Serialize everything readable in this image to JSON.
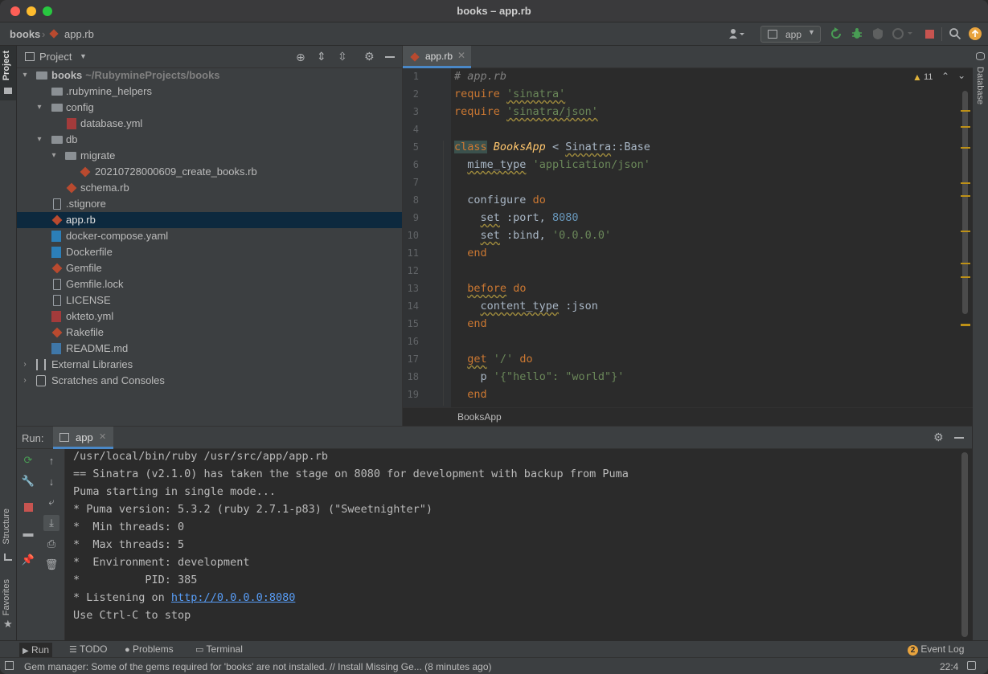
{
  "window": {
    "title": "books – app.rb"
  },
  "navbar": {
    "project": "books",
    "file": "app.rb",
    "run_config": "app"
  },
  "left_stripe": {
    "project": "Project",
    "structure": "Structure",
    "favorites": "Favorites"
  },
  "right_stripe": {
    "database": "Database"
  },
  "project_panel": {
    "title": "Project",
    "tree": [
      {
        "label": "books",
        "path": "~/RubymineProjects/books"
      },
      {
        "label": ".rubymine_helpers"
      },
      {
        "label": "config"
      },
      {
        "label": "database.yml"
      },
      {
        "label": "db"
      },
      {
        "label": "migrate"
      },
      {
        "label": "20210728000609_create_books.rb"
      },
      {
        "label": "schema.rb"
      },
      {
        "label": ".stignore"
      },
      {
        "label": "app.rb"
      },
      {
        "label": "docker-compose.yaml"
      },
      {
        "label": "Dockerfile"
      },
      {
        "label": "Gemfile"
      },
      {
        "label": "Gemfile.lock"
      },
      {
        "label": "LICENSE"
      },
      {
        "label": "okteto.yml"
      },
      {
        "label": "Rakefile"
      },
      {
        "label": "README.md"
      },
      {
        "label": "External Libraries"
      },
      {
        "label": "Scratches and Consoles"
      }
    ]
  },
  "editor": {
    "tab": "app.rb",
    "warnings": "11",
    "breadcrumb": "BooksApp",
    "line_numbers": [
      "1",
      "2",
      "3",
      "4",
      "5",
      "6",
      "7",
      "8",
      "9",
      "10",
      "11",
      "12",
      "13",
      "14",
      "15",
      "16",
      "17",
      "18",
      "19"
    ],
    "code": {
      "l1": "# app.rb",
      "l2_kw": "require",
      "l2_str": "'sinatra'",
      "l3_kw": "require",
      "l3_str": "'sinatra/json'",
      "l5_kw": "class",
      "l5_cls": "BooksApp",
      "l5_op": " < ",
      "l5_base": "Sinatra",
      "l5_sep": "::",
      "l5_base2": "Base",
      "l6_fn": "mime_type",
      "l6_str": "'application/json'",
      "l8_fn": "configure",
      "l8_kw": "do",
      "l9_fn": "set",
      "l9_sym": ":port, ",
      "l9_num": "8080",
      "l10_fn": "set",
      "l10_sym": ":bind, ",
      "l10_str": "'0.0.0.0'",
      "l11_kw": "end",
      "l13_fn": "before",
      "l13_kw": "do",
      "l14_fn": "content_type",
      "l14_sym": " :json",
      "l15_kw": "end",
      "l17_kw": "get",
      "l17_str": "'/'",
      "l17_kw2": "do",
      "l18_fn": "p",
      "l18_str": "'{\"hello\": \"world\"}'",
      "l19_kw": "end"
    }
  },
  "run_panel": {
    "label": "Run:",
    "tab": "app",
    "output": [
      "/usr/local/bin/ruby /usr/src/app/app.rb",
      "== Sinatra (v2.1.0) has taken the stage on 8080 for development with backup from Puma",
      "Puma starting in single mode...",
      "* Puma version: 5.3.2 (ruby 2.7.1-p83) (\"Sweetnighter\")",
      "*  Min threads: 0",
      "*  Max threads: 5",
      "*  Environment: development",
      "*          PID: 385",
      "* Listening on ",
      "Use Ctrl-C to stop"
    ],
    "link": "http://0.0.0.0:8080"
  },
  "bottom_tools": {
    "run": "Run",
    "todo": "TODO",
    "problems": "Problems",
    "terminal": "Terminal",
    "event_log_count": "2",
    "event_log": "Event Log"
  },
  "statusbar": {
    "message": "Gem manager: Some of the gems required for 'books' are not installed. // Install Missing Ge... (8 minutes ago)",
    "position": "22:4"
  },
  "colors": {
    "accent": "#4a88c7",
    "selection": "#0d293e",
    "warning": "#be9117",
    "stop": "#c75450",
    "run": "#499c54"
  }
}
